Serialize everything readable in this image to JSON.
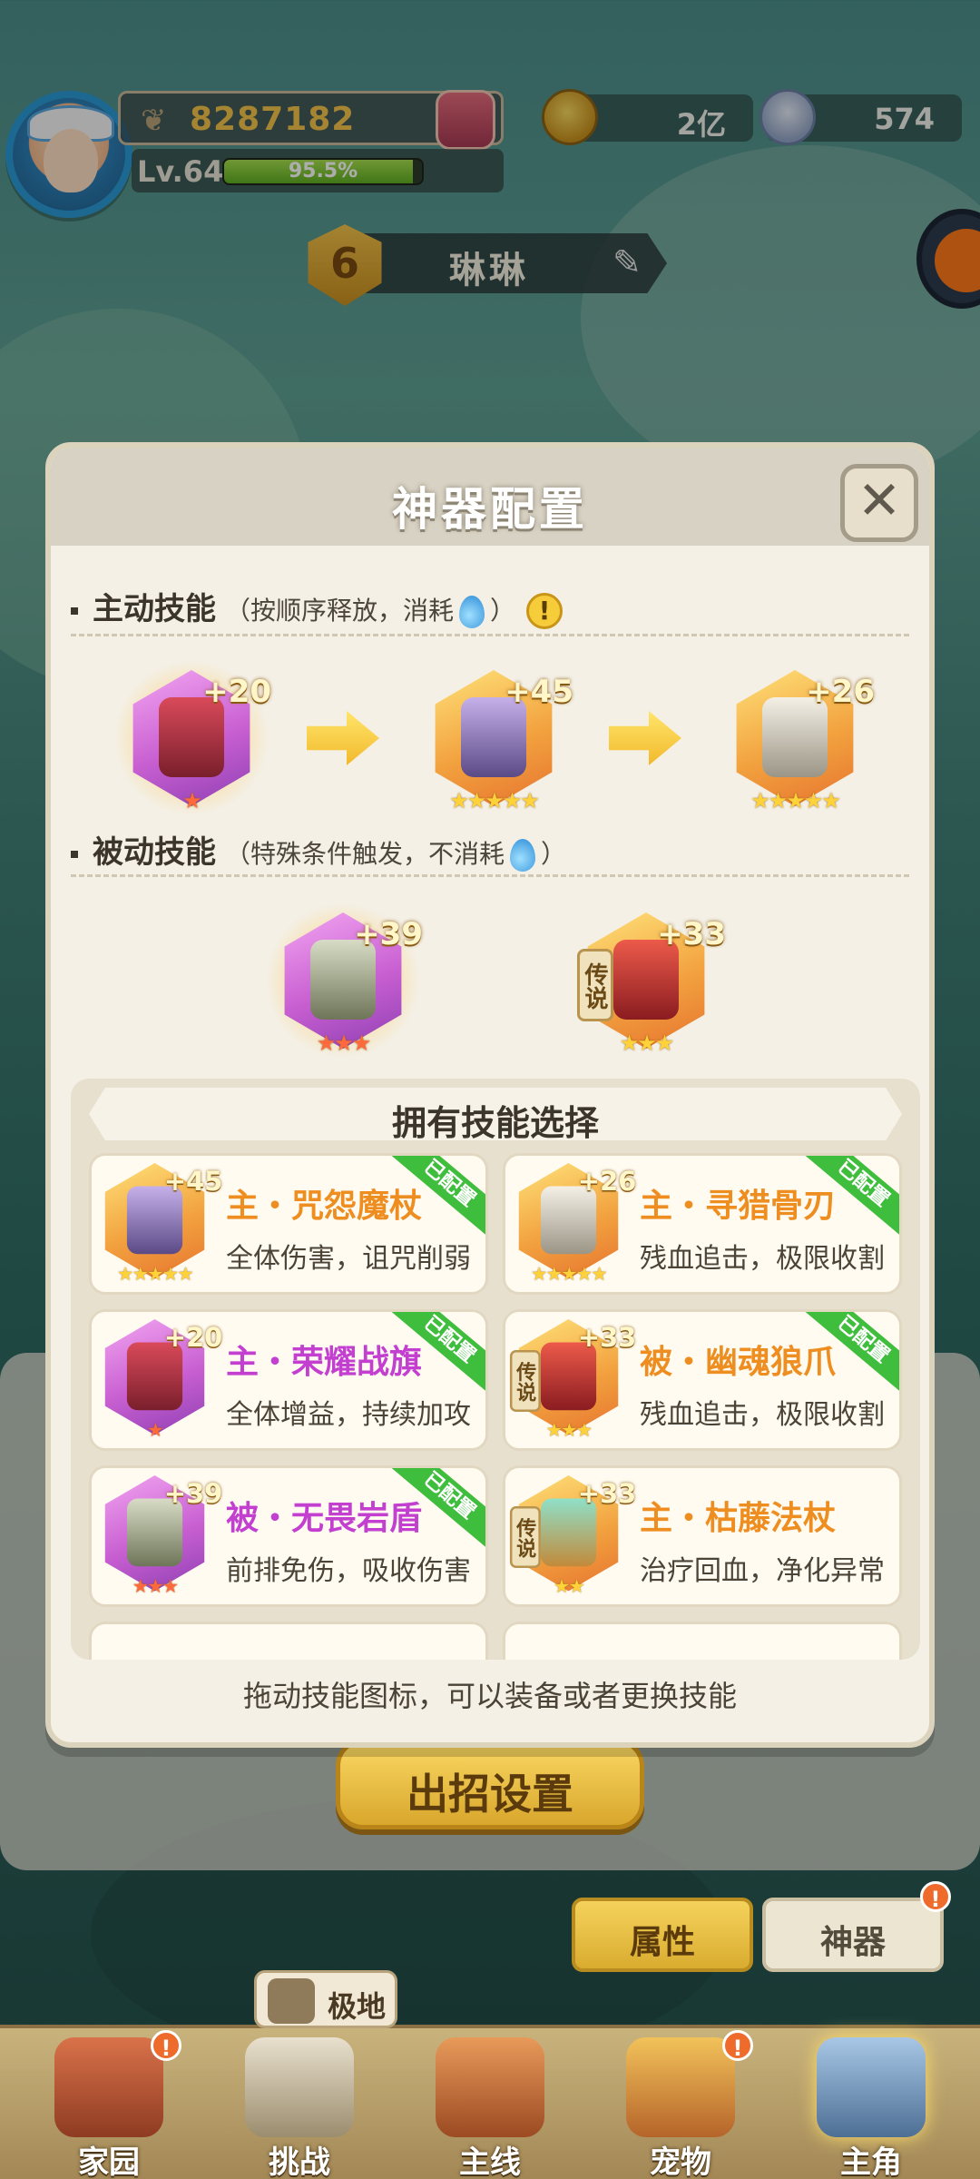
{
  "player": {
    "power": "8287182",
    "level": "Lv.64",
    "exp_percent": 95.5,
    "exp_text": "95.5%",
    "name": "琳琳",
    "rank": "6"
  },
  "resources": {
    "coins": "2亿",
    "shells": "574"
  },
  "modal": {
    "title": "神器配置",
    "close": "✕",
    "active_label": "主动技能",
    "active_note_pre": "（按顺序释放，消耗",
    "active_note_post": "）",
    "passive_label": "被动技能",
    "passive_note_pre": "（特殊条件触发，不消耗",
    "passive_note_post": "）",
    "owned_title": "拥有技能选择",
    "hint": "拖动技能图标，可以装备或者更换技能"
  },
  "active_slots": [
    {
      "plus": "+20",
      "stars": "★",
      "theme": "purple",
      "star_color": "red"
    },
    {
      "plus": "+45",
      "stars": "★★★★★",
      "theme": "gold",
      "star_color": "gold"
    },
    {
      "plus": "+26",
      "stars": "★★★★★",
      "theme": "gold",
      "star_color": "gold"
    }
  ],
  "passive_slots": [
    {
      "plus": "+39",
      "stars": "★★★",
      "theme": "purple",
      "star_color": "red"
    },
    {
      "plus": "+33",
      "stars": "★★★",
      "theme": "gold",
      "star_color": "gold",
      "tag": "传说"
    }
  ],
  "owned": [
    {
      "plus": "+45",
      "name": "主・咒怨魔杖",
      "desc": "全体伤害，诅咒削弱",
      "stars": "★★★★★",
      "theme": "gold",
      "equipped": "已配置"
    },
    {
      "plus": "+26",
      "name": "主・寻猎骨刃",
      "desc": "残血追击，极限收割",
      "stars": "★★★★★",
      "theme": "gold",
      "equipped": "已配置"
    },
    {
      "plus": "+20",
      "name": "主・荣耀战旗",
      "desc": "全体增益，持续加攻",
      "stars": "★",
      "theme": "purple",
      "equipped": "已配置"
    },
    {
      "plus": "+33",
      "name": "被・幽魂狼爪",
      "desc": "残血追击，极限收割",
      "stars": "★★★",
      "theme": "gold",
      "equipped": "已配置",
      "tag": "传说"
    },
    {
      "plus": "+39",
      "name": "被・无畏岩盾",
      "desc": "前排免伤，吸收伤害",
      "stars": "★★★",
      "theme": "purple",
      "equipped": "已配置"
    },
    {
      "plus": "+33",
      "name": "主・枯藤法杖",
      "desc": "治疗回血，净化异常",
      "stars": "★★",
      "theme": "gold",
      "tag": "传说"
    }
  ],
  "buttons": {
    "skill_setup": "出招设置",
    "attributes": "属性",
    "artifact": "神器",
    "alert": "!"
  },
  "challenge_tip": "极地",
  "nav": [
    {
      "label": "家园",
      "alert": true
    },
    {
      "label": "挑战",
      "alert": false
    },
    {
      "label": "主线",
      "alert": false
    },
    {
      "label": "宠物",
      "alert": true
    },
    {
      "label": "主角",
      "alert": false
    }
  ],
  "colors": {
    "gold_text": "#ee8d20",
    "purple_text": "#c23fd0",
    "equipped_ribbon": "#3fbd3c"
  }
}
